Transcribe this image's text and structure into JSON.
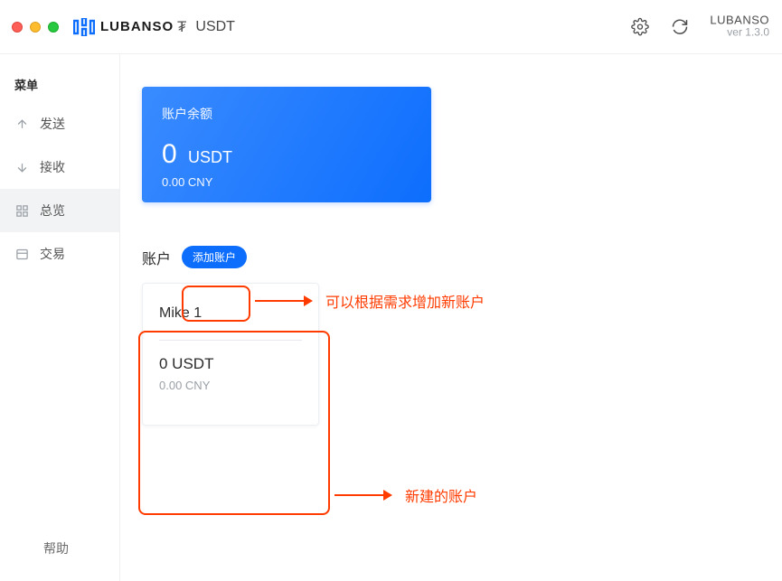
{
  "header": {
    "logo_text": "LUBANSO",
    "currency_label": "USDT",
    "brand": "LUBANSO",
    "version": "ver 1.3.0"
  },
  "sidebar": {
    "title": "菜单",
    "items": [
      {
        "label": "发送"
      },
      {
        "label": "接收"
      },
      {
        "label": "总览"
      },
      {
        "label": "交易"
      }
    ],
    "help": "帮助"
  },
  "balance_card": {
    "title": "账户余额",
    "amount": "0",
    "unit": "USDT",
    "subtext": "0.00 CNY"
  },
  "accounts": {
    "title": "账户",
    "add_label": "添加账户",
    "items": [
      {
        "name": "Mike 1",
        "balance": "0 USDT",
        "sub": "0.00 CNY"
      }
    ]
  },
  "annotations": {
    "add_account_note": "可以根据需求增加新账户",
    "new_account_note": "新建的账户"
  }
}
